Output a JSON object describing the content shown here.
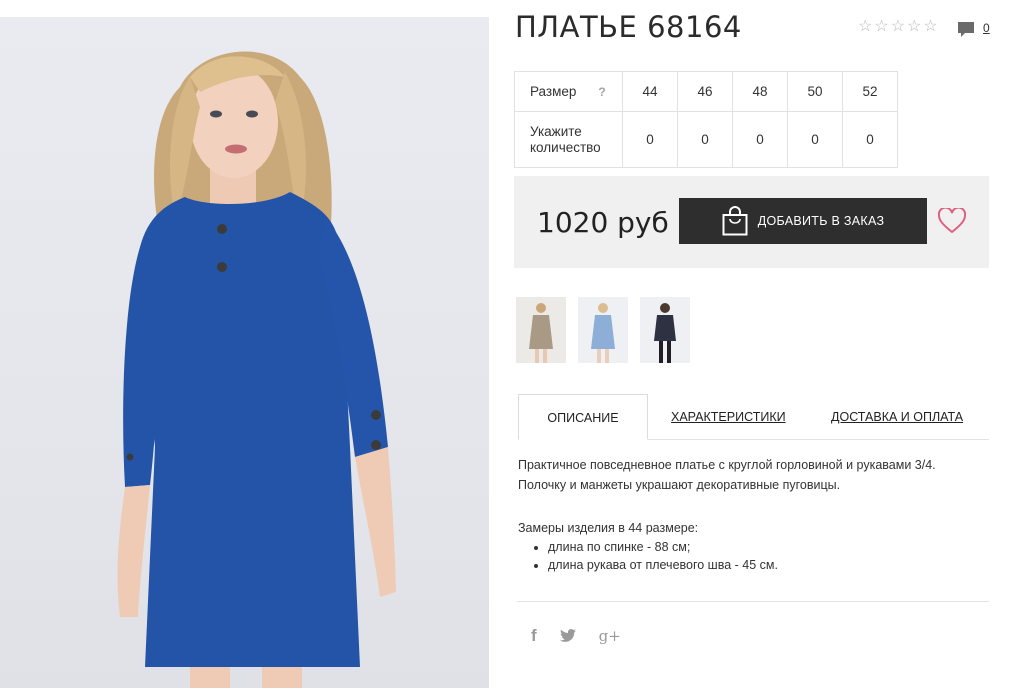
{
  "product": {
    "title": "ПЛАТЬЕ 68164",
    "rating_stars": 0,
    "comment_count": "0"
  },
  "sizes": {
    "size_label": "Размер",
    "help_symbol": "?",
    "qty_label_line1": "Укажите",
    "qty_label_line2": "количество",
    "values": [
      "44",
      "46",
      "48",
      "50",
      "52"
    ],
    "quantities": [
      "0",
      "0",
      "0",
      "0",
      "0"
    ]
  },
  "price": {
    "amount": "1020 руб",
    "add_button": "ДОБАВИТЬ В ЗАКАЗ"
  },
  "thumbnails": [
    "beige-dress",
    "light-blue-dress",
    "navy-dress"
  ],
  "tabs": {
    "description": "ОПИСАНИЕ",
    "characteristics": "ХАРАКТЕРИСТИКИ",
    "delivery": "ДОСТАВКА И ОПЛАТА"
  },
  "description": {
    "line1": "Практичное повседневное платье с круглой горловиной и рукавами 3/4.",
    "line2": "Полочку и манжеты украшают декоративные пуговицы.",
    "measurements_title": "Замеры изделия в 44 размере:",
    "bullets": [
      "длина по спинке - 88 см;",
      "длина рукава от плечевого шва - 45 см."
    ]
  },
  "social": {
    "facebook": "f",
    "google": "g+"
  },
  "colors": {
    "dress_blue": "#2454a8",
    "button_dark": "#2e2e2e",
    "heart_pink": "#e0607e"
  }
}
